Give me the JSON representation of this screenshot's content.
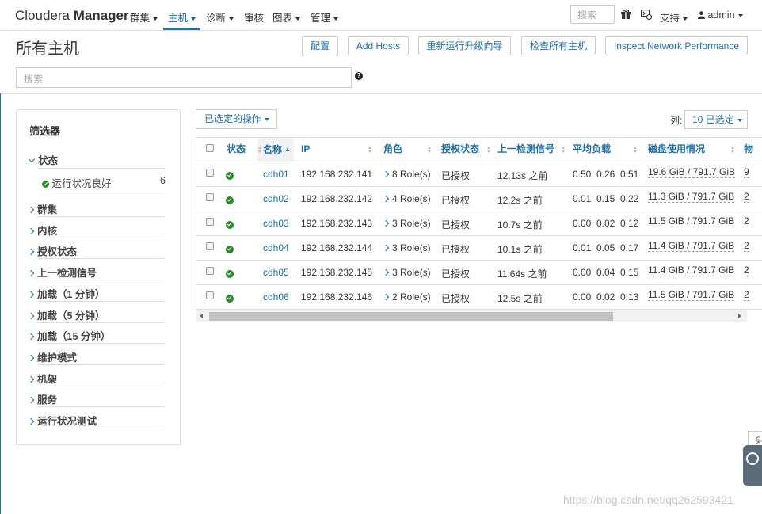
{
  "nav": {
    "brand_light": "Cloudera ",
    "brand_bold": "Manager",
    "items": [
      {
        "label": "群集",
        "dropdown": true
      },
      {
        "label": "主机",
        "dropdown": true,
        "active": true
      },
      {
        "label": "诊断",
        "dropdown": true
      },
      {
        "label": "审核",
        "dropdown": false
      },
      {
        "label": "图表",
        "dropdown": true
      },
      {
        "label": "管理",
        "dropdown": true
      }
    ],
    "search_placeholder": "搜索",
    "support_label": "支持",
    "user_label": "admin"
  },
  "page": {
    "title": "所有主机",
    "buttons": [
      "配置",
      "Add Hosts",
      "重新运行升级向导",
      "检查所有主机",
      "Inspect Network Performance"
    ],
    "search_placeholder": "搜索",
    "help_icon": "?"
  },
  "filters": {
    "title": "筛选器",
    "status_section": "状态",
    "status_item": {
      "label": "运行状况良好",
      "count": "6"
    },
    "sections": [
      "群集",
      "内核",
      "授权状态",
      "上一检测信号",
      "加载（1 分钟）",
      "加载（5 分钟）",
      "加载（15 分钟）",
      "维护模式",
      "机架",
      "服务",
      "运行状况测试"
    ]
  },
  "table": {
    "actions_label": "已选定的操作",
    "columns_label": "列:",
    "columns_selected": "10 已选定",
    "headers": [
      "状态",
      "名称",
      "IP",
      "角色",
      "授权状态",
      "上一检测信号",
      "平均负载",
      "磁盘使用情况",
      "物"
    ],
    "rows": [
      {
        "name": "cdh01",
        "ip": "192.168.232.141",
        "roles": "8 Role(s)",
        "auth": "已授权",
        "heartbeat": "12.13s 之前",
        "load": [
          "0.50",
          "0.26",
          "0.51"
        ],
        "disk": "19.6 GiB / 791.7 GiB",
        "extra": "9"
      },
      {
        "name": "cdh02",
        "ip": "192.168.232.142",
        "roles": "4 Role(s)",
        "auth": "已授权",
        "heartbeat": "12.2s 之前",
        "load": [
          "0.01",
          "0.15",
          "0.22"
        ],
        "disk": "11.3 GiB / 791.7 GiB",
        "extra": "2"
      },
      {
        "name": "cdh03",
        "ip": "192.168.232.143",
        "roles": "3 Role(s)",
        "auth": "已授权",
        "heartbeat": "10.7s 之前",
        "load": [
          "0.00",
          "0.02",
          "0.12"
        ],
        "disk": "11.5 GiB / 791.7 GiB",
        "extra": "2"
      },
      {
        "name": "cdh04",
        "ip": "192.168.232.144",
        "roles": "3 Role(s)",
        "auth": "已授权",
        "heartbeat": "10.1s 之前",
        "load": [
          "0.01",
          "0.05",
          "0.17"
        ],
        "disk": "11.4 GiB / 791.7 GiB",
        "extra": "2"
      },
      {
        "name": "cdh05",
        "ip": "192.168.232.145",
        "roles": "3 Role(s)",
        "auth": "已授权",
        "heartbeat": "11.64s 之前",
        "load": [
          "0.00",
          "0.04",
          "0.15"
        ],
        "disk": "11.4 GiB / 791.7 GiB",
        "extra": "2"
      },
      {
        "name": "cdh06",
        "ip": "192.168.232.146",
        "roles": "2 Role(s)",
        "auth": "已授权",
        "heartbeat": "12.5s 之前",
        "load": [
          "0.00",
          "0.02",
          "0.13"
        ],
        "disk": "11.5 GiB / 791.7 GiB",
        "extra": "2"
      }
    ]
  },
  "watermark": "https://blog.csdn.net/qq262593421",
  "side_widget": {
    "tab_label": "ok"
  },
  "colors": {
    "accent": "#1d6fa5",
    "good": "#2b8a2b",
    "border": "#dddddd"
  }
}
